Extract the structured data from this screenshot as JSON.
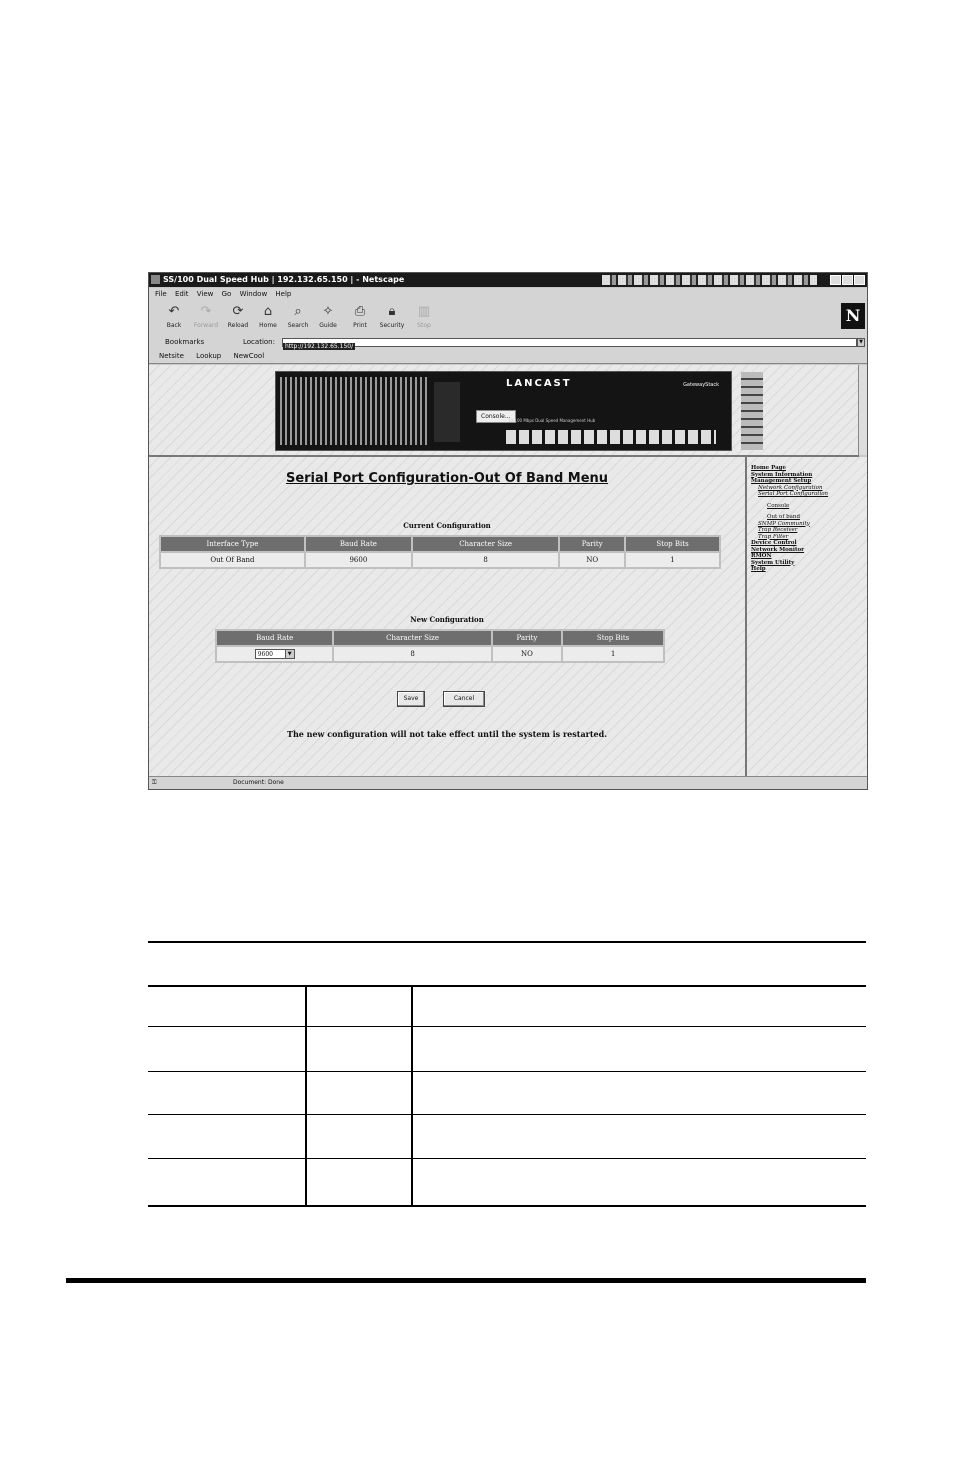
{
  "browser": {
    "title": "SS/100 Dual Speed Hub | 192.132.65.150 | - Netscape",
    "menu": [
      "File",
      "Edit",
      "View",
      "Go",
      "Window",
      "Help"
    ],
    "toolbar": [
      {
        "label": "Back",
        "icon": "back-arrow-icon"
      },
      {
        "label": "Forward",
        "icon": "forward-arrow-icon"
      },
      {
        "label": "Reload",
        "icon": "reload-icon"
      },
      {
        "label": "Home",
        "icon": "home-icon"
      },
      {
        "label": "Search",
        "icon": "search-icon"
      },
      {
        "label": "Guide",
        "icon": "guide-icon"
      },
      {
        "label": "Print",
        "icon": "print-icon"
      },
      {
        "label": "Security",
        "icon": "security-icon"
      },
      {
        "label": "Stop",
        "icon": "stop-icon"
      }
    ],
    "bookmarks_label": "Bookmarks",
    "location_label": "Location:",
    "url": "http://192.132.65.150/",
    "personal": [
      "Netsite",
      "Lookup",
      "NewCool"
    ],
    "status": "Document: Done"
  },
  "hub": {
    "brand": "LANCAST",
    "model": "GatewayStack",
    "console_label": "Console...",
    "subtitle": "10/100 Mbps Dual Speed Management Hub"
  },
  "page": {
    "title": "Serial Port Configuration-Out Of Band Menu",
    "current_caption": "Current Configuration",
    "current_headers": [
      "Interface Type",
      "Baud Rate",
      "Character Size",
      "Parity",
      "Stop Bits"
    ],
    "current_row": [
      "Out Of Band",
      "9600",
      "8",
      "NO",
      "1"
    ],
    "new_caption": "New Configuration",
    "new_headers": [
      "Baud Rate",
      "Character Size",
      "Parity",
      "Stop Bits"
    ],
    "new_baud_selected": "9600",
    "new_row": [
      "8",
      "NO",
      "1"
    ],
    "save_label": "Save",
    "cancel_label": "Cancel",
    "note": "The new configuration will not take effect until the system is restarted."
  },
  "nav": {
    "items": [
      {
        "label": "Home Page",
        "level": 0
      },
      {
        "label": "System Information",
        "level": 0
      },
      {
        "label": "Management Setup",
        "level": 0
      },
      {
        "label": "Network Configuration",
        "level": 1
      },
      {
        "label": "Serial Port Configuration",
        "level": 1
      },
      {
        "label": "Console",
        "level": 2
      },
      {
        "label": "Out of band",
        "level": 2
      },
      {
        "label": "SNMP Community",
        "level": 1
      },
      {
        "label": "Trap Receiver",
        "level": 1
      },
      {
        "label": "Trap Filter",
        "level": 1
      },
      {
        "label": "Device Control",
        "level": 0
      },
      {
        "label": "Network Monitor",
        "level": 0
      },
      {
        "label": "RMON",
        "level": 0
      },
      {
        "label": "System Utility",
        "level": 0
      },
      {
        "label": "Help",
        "level": 0
      }
    ]
  }
}
